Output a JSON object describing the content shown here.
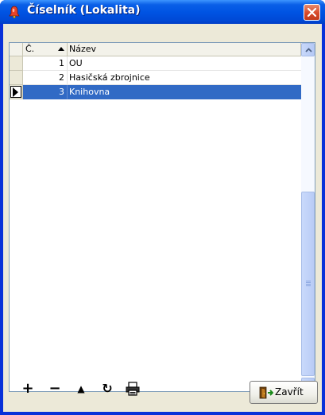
{
  "window": {
    "title": "Číselník (Lokalita)",
    "icon": "bell-icon",
    "close_icon": "close-x-icon"
  },
  "grid": {
    "columns": [
      "Č.",
      "Název"
    ],
    "sort_column": "Název",
    "rows": [
      {
        "num": "1",
        "name": "OU",
        "selected": false
      },
      {
        "num": "2",
        "name": "Hasičská zbrojnice",
        "selected": false
      },
      {
        "num": "3",
        "name": "Knihovna",
        "selected": true
      }
    ]
  },
  "toolbar": {
    "add_label": "+",
    "remove_label": "−",
    "up_label": "▲",
    "refresh_label": "↻",
    "print_icon": "printer-icon",
    "close_label": "Zavřít",
    "close_icon": "exit-door-icon"
  },
  "colors": {
    "titlebar": "#0054e3",
    "selection": "#316ac5",
    "close_button": "#d8492a",
    "client": "#ece9d8"
  }
}
